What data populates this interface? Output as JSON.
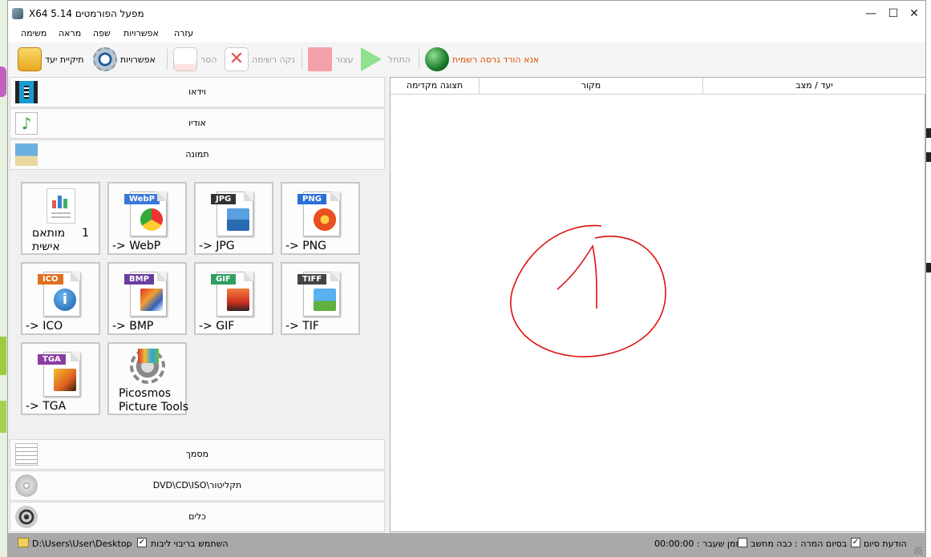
{
  "window": {
    "title": "X64 5.14 מפעל הפורמטים",
    "controls": {
      "minimize": "—",
      "maximize": "☐",
      "close": "✕"
    }
  },
  "menu": [
    "משימה",
    "מראה",
    "שפה",
    "אפשרויות",
    "עזרה"
  ],
  "toolbar": {
    "target_folder": "תיקיית יעד",
    "options": "אפשרויות",
    "remove": "הסר",
    "clear_list": "נקה רשימה",
    "stop": "עצור",
    "start": "התחל",
    "download": "אנא הורד גרסה רשמית"
  },
  "categories": {
    "video": "וידאו",
    "audio": "אודיו",
    "image": "תמונה",
    "document": "מסמך",
    "rom": "DVD\\CD\\ISO\\תקליטור",
    "tools": "כלים"
  },
  "tiles": [
    {
      "label1": "1",
      "label2": "מותאם",
      "label3": "אישית"
    },
    {
      "tag": "WebP",
      "label": "-> WebP",
      "tag_color": "#3c78d8"
    },
    {
      "tag": "JPG",
      "label": "-> JPG",
      "tag_color": "#333333"
    },
    {
      "tag": "PNG",
      "label": "-> PNG",
      "tag_color": "#2a6fd6"
    },
    {
      "tag": "ICO",
      "label": "-> ICO",
      "tag_color": "#e07020"
    },
    {
      "tag": "BMP",
      "label": "-> BMP",
      "tag_color": "#6a3ea0"
    },
    {
      "tag": "GIF",
      "label": "-> GIF",
      "tag_color": "#2ea060"
    },
    {
      "tag": "TIFF",
      "label": "-> TIF",
      "tag_color": "#444444"
    },
    {
      "tag": "TGA",
      "label": "-> TGA",
      "tag_color": "#8a3ea0"
    },
    {
      "label1": "Picosmos",
      "label2": "Picture Tools"
    }
  ],
  "columns": {
    "preview": "תצוגה מקדימה",
    "source": "מקור",
    "target": "יעד / מצב"
  },
  "statusbar": {
    "path": "D:\\Users\\User\\Desktop",
    "multithread": "השתמש בריבוי ליבות",
    "elapsed": "00:00:00 : זמן שעבר",
    "on_complete": "בסיום המרה : כבה מחשב",
    "notify": "הודעת סיום"
  }
}
